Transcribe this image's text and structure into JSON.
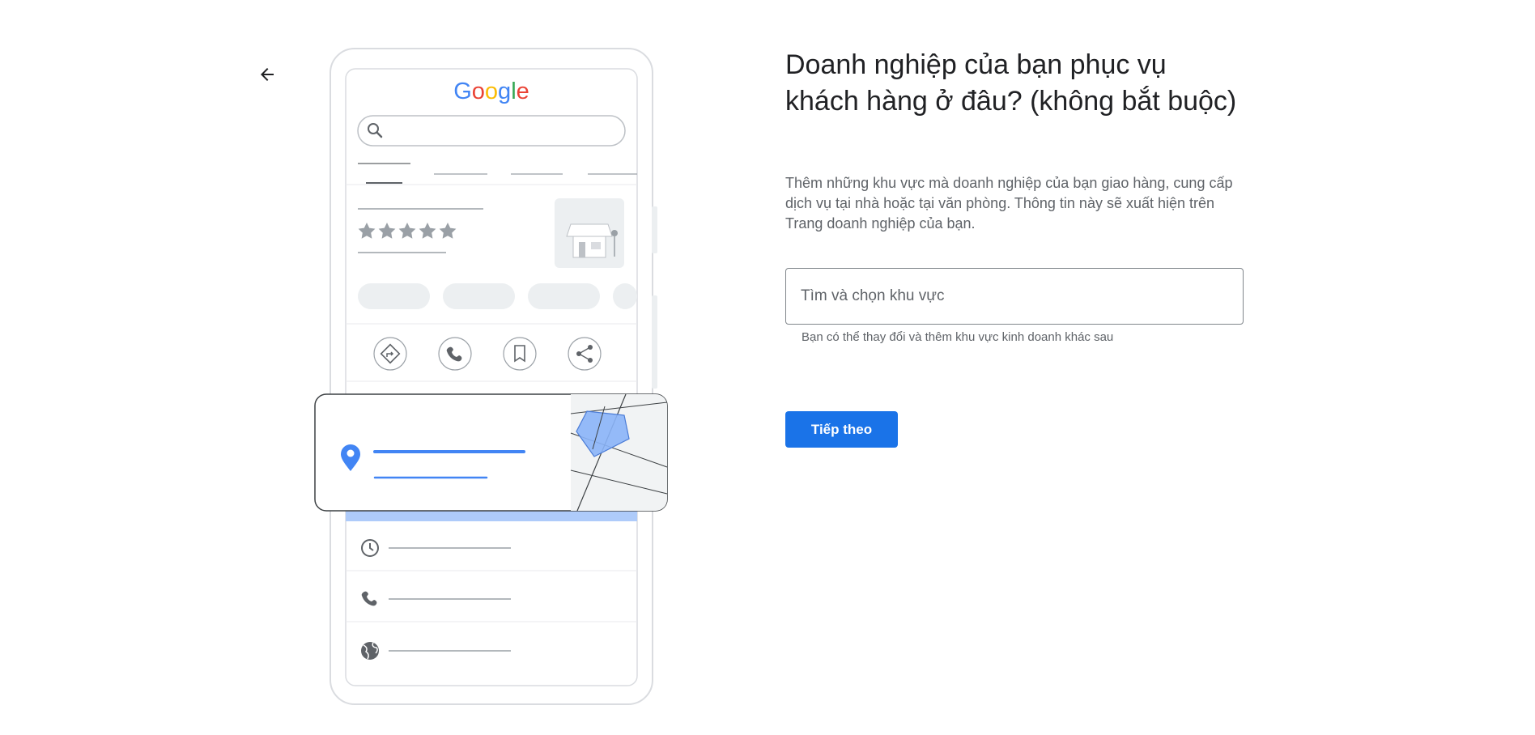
{
  "nav": {
    "back_icon": "arrow-left-icon"
  },
  "illustration": {
    "logo_text": "Google",
    "logo_colors": [
      "#4285F4",
      "#EA4335",
      "#FBBC05",
      "#4285F4",
      "#34A853",
      "#EA4335"
    ],
    "rating_stars": 5,
    "icons": [
      "search-icon",
      "store-icon",
      "directions-icon",
      "phone-icon",
      "bookmark-icon",
      "share-icon",
      "location-pin-icon",
      "clock-icon",
      "phone-icon",
      "globe-icon"
    ]
  },
  "main": {
    "title": "Doanh nghiệp của bạn phục vụ khách hàng ở đâu? (không bắt buộc)",
    "description": "Thêm những khu vực mà doanh nghiệp của bạn giao hàng, cung cấp dịch vụ tại nhà hoặc tại văn phòng. Thông tin này sẽ xuất hiện trên Trang doanh nghiệp của bạn.",
    "search": {
      "placeholder": "Tìm và chọn khu vực",
      "value": ""
    },
    "helper": "Bạn có thể thay đổi và thêm khu vực kinh doanh khác sau",
    "next_label": "Tiếp theo"
  },
  "colors": {
    "accent": "#1a73e8",
    "map_area": "#8ab4f8"
  }
}
